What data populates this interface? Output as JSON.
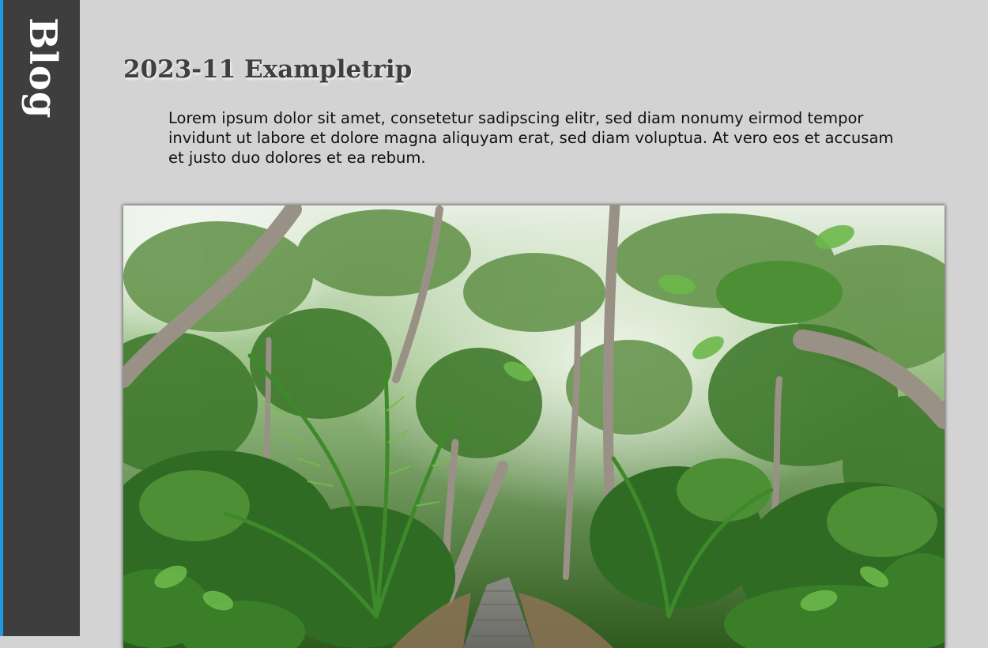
{
  "sidebar": {
    "title": "Blog",
    "accent_color": "#1e9be0",
    "background_color": "#3e3e3e"
  },
  "post": {
    "title": "2023-11 Exampletrip",
    "body": "Lorem ipsum dolor sit amet, consetetur sadipscing elitr, sed diam nonumy eirmod tempor invidunt ut labore et dolore magna aliquyam erat, sed diam voluptua. At vero eos et accusam et justo duo dolores et ea rebum.",
    "photo": {
      "subject": "jungle-path-photo"
    }
  },
  "page": {
    "background_color": "#d3d3d3"
  }
}
